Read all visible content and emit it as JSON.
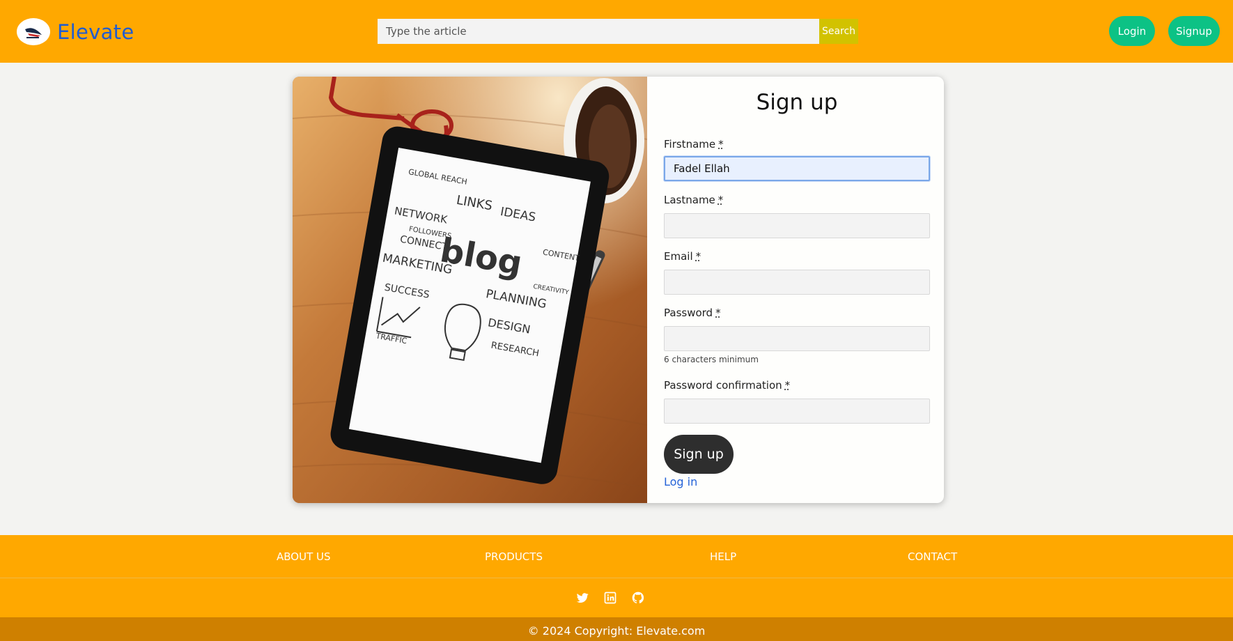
{
  "header": {
    "brand": "Elevate",
    "search_placeholder": "Type the article",
    "search_label": "Search",
    "login_label": "Login",
    "signup_label": "Signup"
  },
  "signup": {
    "title": "Sign up",
    "fields": {
      "firstname": {
        "label": "Firstname",
        "required": "*",
        "value": "Fadel Ellah"
      },
      "lastname": {
        "label": "Lastname",
        "required": "*",
        "value": ""
      },
      "email": {
        "label": "Email",
        "required": "*",
        "value": ""
      },
      "password": {
        "label": "Password",
        "required": "*",
        "value": "",
        "hint": "6 characters minimum"
      },
      "password_confirmation": {
        "label": "Password confirmation",
        "required": "*",
        "value": ""
      }
    },
    "submit_label": "Sign up",
    "login_link": "Log in"
  },
  "photo": {
    "tablet_words": [
      "GLOBAL REACH",
      "LINKS",
      "IDEAS",
      "NETWORK",
      "FOLLOWERS",
      "CONNECT",
      "blog",
      "CONTENT",
      "MARKETING",
      "PLANNING",
      "CREATIVITY",
      "SUCCESS",
      "DESIGN",
      "RESEARCH",
      "TRAFFIC"
    ]
  },
  "footer": {
    "links": [
      "ABOUT US",
      "PRODUCTS",
      "HELP",
      "CONTACT"
    ],
    "social_icons": [
      "twitter-icon",
      "linkedin-icon",
      "github-icon"
    ],
    "copyright": "© 2024 Copyright: Elevate.com"
  },
  "colors": {
    "navbar": "#ffa800",
    "brand_text": "#1f5cd1",
    "search_button": "#d2c200",
    "nav_button": "#0cc285",
    "submit_button": "#2e2e2e",
    "link": "#2563d8",
    "copyright_bar": "#cf8000"
  }
}
